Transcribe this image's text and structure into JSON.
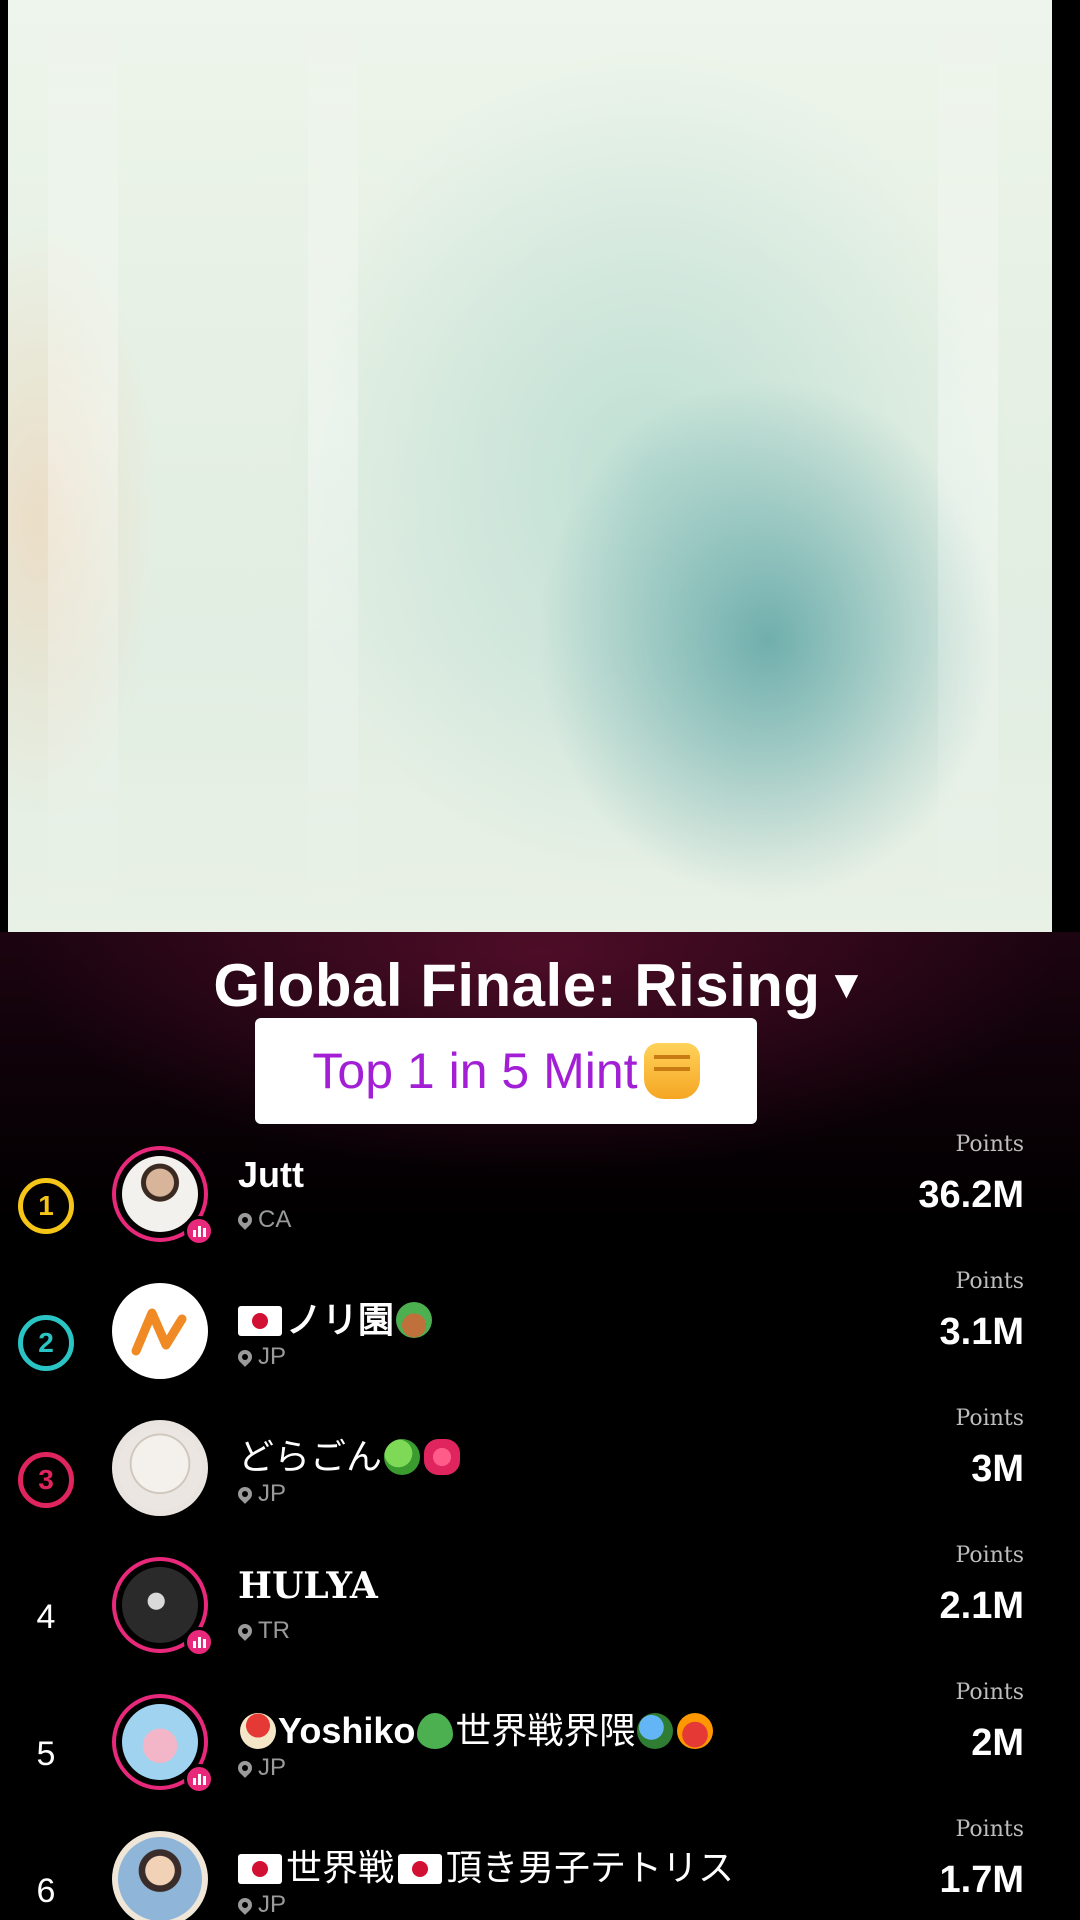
{
  "board": {
    "title": "Global Finale: Rising",
    "caret": "▼",
    "banner_text": "Top 1 in 5 Mint"
  },
  "colors": {
    "accent_pink": "#e8287a",
    "banner_text": "#a21fd6",
    "gold": "#f5c518",
    "teal": "#2bc4c4",
    "red": "#e0245e"
  },
  "entries": [
    {
      "rank": "1",
      "name": "Jutt",
      "region": "CA",
      "points_label": "Points",
      "points": "36.2M",
      "live": true
    },
    {
      "rank": "2",
      "name": "ノリ園",
      "region": "JP",
      "points_label": "Points",
      "points": "3.1M",
      "live": false
    },
    {
      "rank": "3",
      "name": "どらごん",
      "region": "JP",
      "points_label": "Points",
      "points": "3M",
      "live": false
    },
    {
      "rank": "4",
      "name": "HULYA",
      "region": "TR",
      "points_label": "Points",
      "points": "2.1M",
      "live": true
    },
    {
      "rank": "5",
      "name_a": "Yoshiko",
      "name_b": "世界戦界隈",
      "region": "JP",
      "points_label": "Points",
      "points": "2M",
      "live": true
    },
    {
      "rank": "6",
      "name_a": "世界戦",
      "name_b": "頂き男子テトリス",
      "region": "JP",
      "points_label": "Points",
      "points": "1.7M",
      "live": false
    }
  ]
}
